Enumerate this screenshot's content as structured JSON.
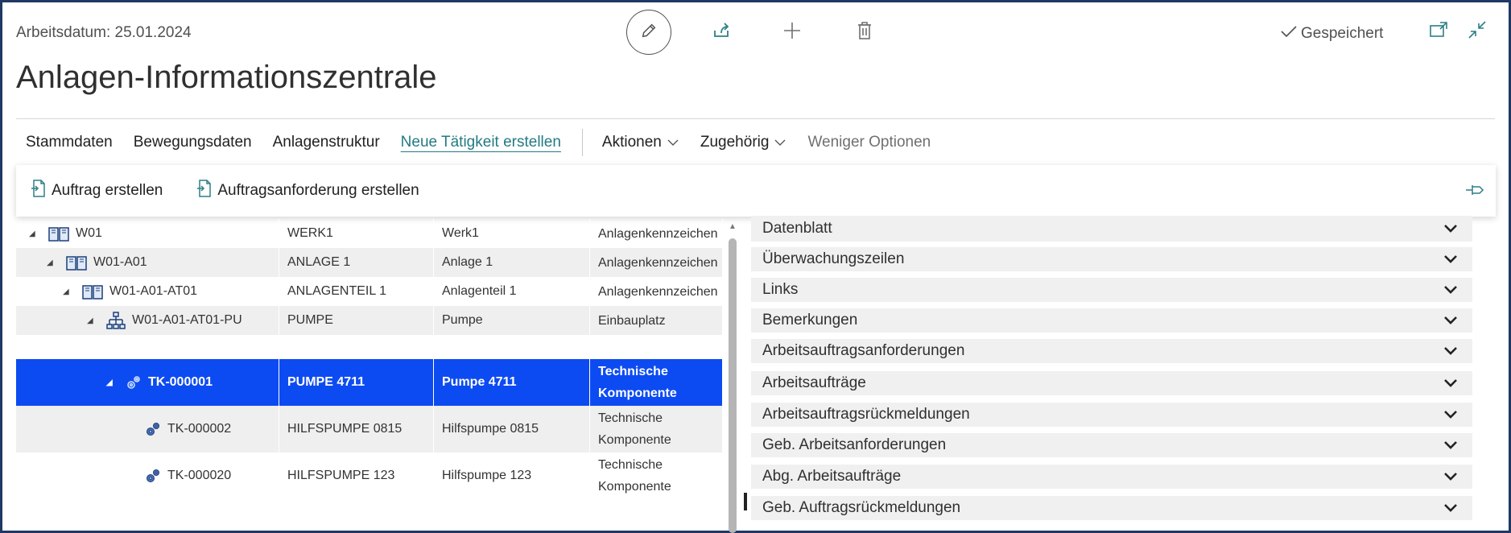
{
  "header": {
    "work_date": "Arbeitsdatum: 25.01.2024",
    "saved_label": "Gespeichert",
    "page_title": "Anlagen-Informationszentrale"
  },
  "actions": [
    {
      "label": "Stammdaten"
    },
    {
      "label": "Bewegungsdaten"
    },
    {
      "label": "Anlagenstruktur"
    },
    {
      "label": "Neue Tätigkeit erstellen"
    },
    {
      "label": "Aktionen"
    },
    {
      "label": "Zugehörig"
    },
    {
      "label": "Weniger Optionen"
    }
  ],
  "subactions": [
    {
      "label": "Auftrag erstellen"
    },
    {
      "label": "Auftragsanforderung erstellen"
    }
  ],
  "tree": [
    {
      "level": 0,
      "no": "W01",
      "name": "WERK1",
      "description": "Werk1",
      "type": "Anlagenkennzeichen",
      "icon": "book-icon"
    },
    {
      "level": 1,
      "no": "W01-A01",
      "name": "ANLAGE 1",
      "description": "Anlage 1",
      "type": "Anlagenkennzeichen",
      "icon": "book-icon"
    },
    {
      "level": 2,
      "no": "W01-A01-AT01",
      "name": "ANLAGENTEIL 1",
      "description": "Anlagenteil 1",
      "type": "Anlagenkennzeichen",
      "icon": "book-icon"
    },
    {
      "level": 3,
      "no": "W01-A01-AT01-PU",
      "name": "PUMPE",
      "description": "Pumpe",
      "type": "Einbauplatz",
      "icon": "hierarchy-icon"
    },
    {
      "level": 4,
      "no": "TK-000001",
      "name": "PUMPE 4711",
      "description": "Pumpe 4711",
      "type": "Technische Komponente",
      "icon": "gears-icon"
    },
    {
      "level": 5,
      "no": "TK-000002",
      "name": "HILFSPUMPE 0815",
      "description": "Hilfspumpe 0815",
      "type": "Technische Komponente",
      "icon": "gears-icon"
    },
    {
      "level": 5,
      "no": "TK-000020",
      "name": "HILFSPUMPE 123",
      "description": "Hilfspumpe 123",
      "type": "Technische Komponente",
      "icon": "gears-icon"
    }
  ],
  "factboxes": [
    {
      "label": "Datenblatt"
    },
    {
      "label": "Überwachungszeilen"
    },
    {
      "label": "Links"
    },
    {
      "label": "Bemerkungen"
    },
    {
      "label": "Arbeitsauftragsanforderungen"
    },
    {
      "label": "Arbeitsaufträge"
    },
    {
      "label": "Arbeitsauftragsrückmeldungen"
    },
    {
      "label": "Geb. Arbeitsanforderungen"
    },
    {
      "label": "Abg. Arbeitsaufträge"
    },
    {
      "label": "Geb. Auftragsrückmeldungen"
    }
  ],
  "colors": {
    "accent": "#237a83",
    "selection": "#0d4bf2",
    "frame": "#1f3864"
  }
}
